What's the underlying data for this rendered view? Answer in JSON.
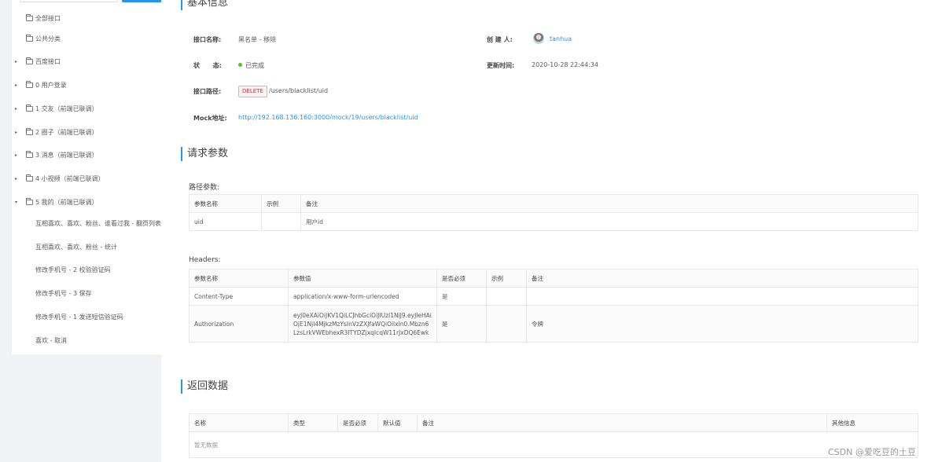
{
  "sidebar": {
    "items": [
      {
        "label": "全部接口",
        "caret": "",
        "folder": true
      },
      {
        "label": "公共分类",
        "caret": "",
        "folder": true
      },
      {
        "label": "百度接口",
        "caret": "▸",
        "folder": true
      },
      {
        "label": "0 用户登录",
        "caret": "▸",
        "folder": true
      },
      {
        "label": "1 交友（前端已联调）",
        "caret": "▸",
        "folder": true
      },
      {
        "label": "2 圈子（前端已联调）",
        "caret": "▸",
        "folder": true
      },
      {
        "label": "3 消息（前端已联调）",
        "caret": "▸",
        "folder": true
      },
      {
        "label": "4 小视频（前端已联调）",
        "caret": "▸",
        "folder": true
      },
      {
        "label": "5 我的（前端已联调）",
        "caret": "▾",
        "folder": true
      },
      {
        "label": "互相喜欢、喜欢、粉丝、谁看过我 - 翻页列表",
        "caret": "",
        "folder": false
      },
      {
        "label": "互相喜欢、喜欢、粉丝 - 统计",
        "caret": "",
        "folder": false
      },
      {
        "label": "修改手机号 - 2 校验验证码",
        "caret": "",
        "folder": false
      },
      {
        "label": "修改手机号 - 3 保存",
        "caret": "",
        "folder": false
      },
      {
        "label": "修改手机号 - 1 发送短信验证码",
        "caret": "",
        "folder": false
      },
      {
        "label": "喜欢 - 取消",
        "caret": "",
        "folder": false
      }
    ]
  },
  "basic_info": {
    "title": "基本信息",
    "name_label": "接口名称:",
    "name_value": "黑名单 - 移除",
    "creator_label": "创 建 人:",
    "creator_value": "tanhua",
    "status_label": "状      态:",
    "status_value": "已完成",
    "updated_label": "更新时间:",
    "updated_value": "2020-10-28 22:44:34",
    "path_label": "接口路径:",
    "method": "DELETE",
    "path_value": "/users/blacklist/uid",
    "mock_label": "Mock地址:",
    "mock_value": "http://192.168.136.160:3000/mock/19/users/blacklist/uid"
  },
  "request": {
    "title": "请求参数",
    "path_params_label": "路径参数:",
    "path_params": {
      "headers": [
        "参数名称",
        "示例",
        "备注"
      ],
      "rows": [
        [
          "uid",
          "",
          "用户id"
        ]
      ]
    },
    "headers_label": "Headers:",
    "headers_table": {
      "headers": [
        "参数名称",
        "参数值",
        "是否必须",
        "示例",
        "备注"
      ],
      "rows": [
        [
          "Content-Type",
          "application/x-www-form-urlencoded",
          "是",
          "",
          ""
        ],
        [
          "Authorization",
          "eyJ0eXAiOiJKV1QiLCJhbGciOiJIUzI1NiJ9.eyJleHAiOjE1NjI4MjkzMzYsInVzZXJfaWQiOilxIn0.Mbzn6LzsLrkVWEbhexR3ITYDZjxqIcqW11rJxDQ6Ewk",
          "是",
          "",
          "令牌"
        ]
      ]
    }
  },
  "response": {
    "title": "返回数据",
    "table": {
      "headers": [
        "名称",
        "类型",
        "是否必须",
        "默认值",
        "备注",
        "其他信息"
      ],
      "empty": "暂无数据"
    }
  },
  "watermark": "CSDN @爱吃豆的土豆"
}
